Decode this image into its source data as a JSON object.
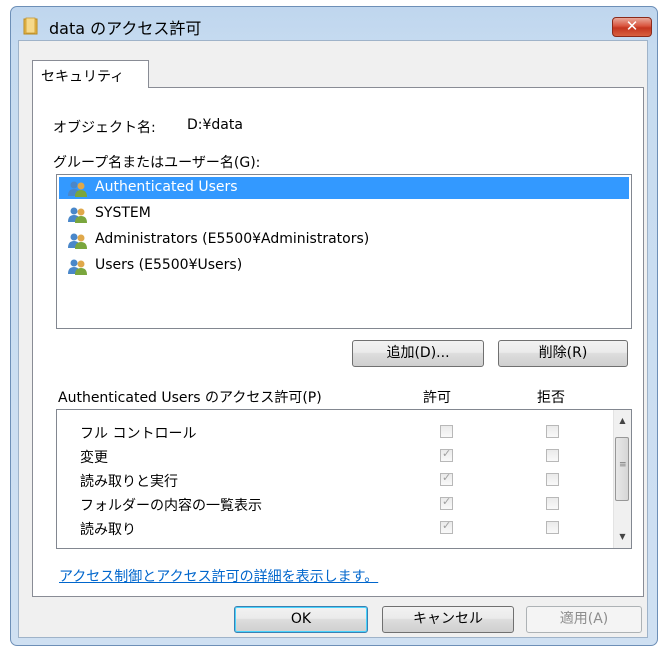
{
  "window": {
    "title": "data のアクセス許可",
    "close_symbol": "✕"
  },
  "tabs": [
    {
      "label": "セキュリティ",
      "selected": true
    }
  ],
  "object": {
    "label": "オブジェクト名:",
    "value": "D:¥data"
  },
  "groups": {
    "label": "グループ名またはユーザー名(G):",
    "items": [
      {
        "name": "Authenticated Users",
        "icon": "users-icon",
        "selected": true
      },
      {
        "name": "SYSTEM",
        "icon": "users-icon",
        "selected": false
      },
      {
        "name": "Administrators (E5500¥Administrators)",
        "icon": "users-icon",
        "selected": false
      },
      {
        "name": "Users (E5500¥Users)",
        "icon": "users-icon",
        "selected": false
      }
    ],
    "add_label": "追加(D)...",
    "remove_label": "削除(R)"
  },
  "permissions": {
    "label": "Authenticated Users のアクセス許可(P)",
    "allow_header": "許可",
    "deny_header": "拒否",
    "rows": [
      {
        "name": "フル コントロール",
        "allow": false,
        "deny": false
      },
      {
        "name": "変更",
        "allow": true,
        "deny": false
      },
      {
        "name": "読み取りと実行",
        "allow": true,
        "deny": false
      },
      {
        "name": "フォルダーの内容の一覧表示",
        "allow": true,
        "deny": false
      },
      {
        "name": "読み取り",
        "allow": true,
        "deny": false
      }
    ]
  },
  "detail_link": "アクセス制御とアクセス許可の詳細を表示します。",
  "buttons": {
    "ok": "OK",
    "cancel": "キャンセル",
    "apply": "適用(A)"
  },
  "colors": {
    "selection": "#3399ff",
    "link": "#0066cc",
    "close": "#c4351f"
  }
}
